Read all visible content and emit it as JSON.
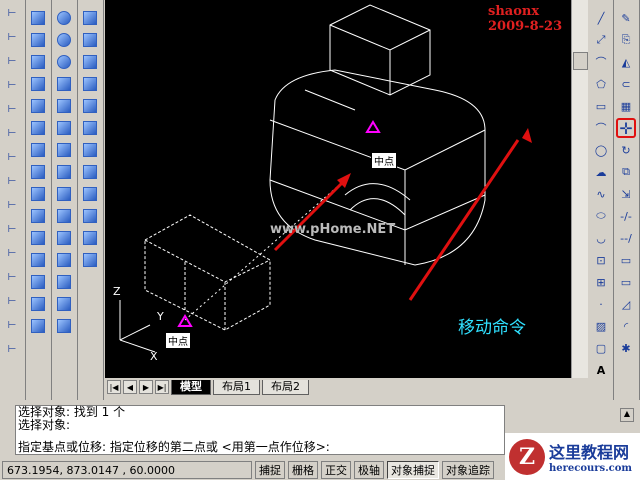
{
  "watermark": "shaonx 2009-8-23",
  "site_watermark": "www.pHome.NET",
  "labels": {
    "midpoint_1": "中点",
    "midpoint_2": "中点",
    "annotation": "移动命令"
  },
  "axes": {
    "z": "Z",
    "y": "Y",
    "x": "X"
  },
  "tabs": {
    "model": "模型",
    "layout1": "布局1",
    "layout2": "布局2"
  },
  "command_lines": [
    "选择对象: 找到 1 个",
    "选择对象:",
    "指定基点或位移: 指定位移的第二点或 <用第一点作位移>:"
  ],
  "status": {
    "coords": "673.1954, 873.0147 , 60.0000",
    "buttons": [
      "捕捉",
      "栅格",
      "正交",
      "极轴",
      "对象捕捉",
      "对象追踪"
    ],
    "active": "对象捕捉"
  },
  "logo": {
    "title": "这里教程网",
    "url": "herecours.com"
  },
  "colors": {
    "arrow": "#e01010",
    "annotation": "#30e0ff",
    "marker": "#ff00ff"
  }
}
